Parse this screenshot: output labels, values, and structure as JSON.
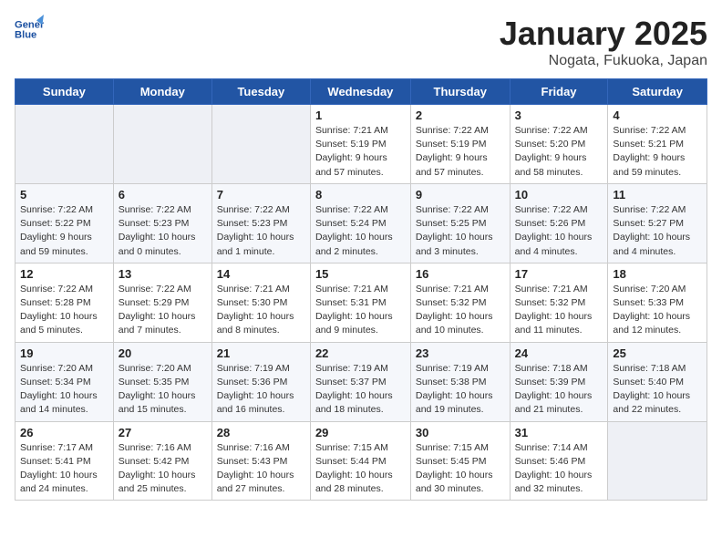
{
  "header": {
    "logo_line1": "General",
    "logo_line2": "Blue",
    "month": "January 2025",
    "location": "Nogata, Fukuoka, Japan"
  },
  "weekdays": [
    "Sunday",
    "Monday",
    "Tuesday",
    "Wednesday",
    "Thursday",
    "Friday",
    "Saturday"
  ],
  "weeks": [
    [
      {
        "day": "",
        "empty": true
      },
      {
        "day": "",
        "empty": true
      },
      {
        "day": "",
        "empty": true
      },
      {
        "day": "1",
        "sunrise": "Sunrise: 7:21 AM",
        "sunset": "Sunset: 5:19 PM",
        "daylight": "Daylight: 9 hours and 57 minutes."
      },
      {
        "day": "2",
        "sunrise": "Sunrise: 7:22 AM",
        "sunset": "Sunset: 5:19 PM",
        "daylight": "Daylight: 9 hours and 57 minutes."
      },
      {
        "day": "3",
        "sunrise": "Sunrise: 7:22 AM",
        "sunset": "Sunset: 5:20 PM",
        "daylight": "Daylight: 9 hours and 58 minutes."
      },
      {
        "day": "4",
        "sunrise": "Sunrise: 7:22 AM",
        "sunset": "Sunset: 5:21 PM",
        "daylight": "Daylight: 9 hours and 59 minutes."
      }
    ],
    [
      {
        "day": "5",
        "sunrise": "Sunrise: 7:22 AM",
        "sunset": "Sunset: 5:22 PM",
        "daylight": "Daylight: 9 hours and 59 minutes."
      },
      {
        "day": "6",
        "sunrise": "Sunrise: 7:22 AM",
        "sunset": "Sunset: 5:23 PM",
        "daylight": "Daylight: 10 hours and 0 minutes."
      },
      {
        "day": "7",
        "sunrise": "Sunrise: 7:22 AM",
        "sunset": "Sunset: 5:23 PM",
        "daylight": "Daylight: 10 hours and 1 minute."
      },
      {
        "day": "8",
        "sunrise": "Sunrise: 7:22 AM",
        "sunset": "Sunset: 5:24 PM",
        "daylight": "Daylight: 10 hours and 2 minutes."
      },
      {
        "day": "9",
        "sunrise": "Sunrise: 7:22 AM",
        "sunset": "Sunset: 5:25 PM",
        "daylight": "Daylight: 10 hours and 3 minutes."
      },
      {
        "day": "10",
        "sunrise": "Sunrise: 7:22 AM",
        "sunset": "Sunset: 5:26 PM",
        "daylight": "Daylight: 10 hours and 4 minutes."
      },
      {
        "day": "11",
        "sunrise": "Sunrise: 7:22 AM",
        "sunset": "Sunset: 5:27 PM",
        "daylight": "Daylight: 10 hours and 4 minutes."
      }
    ],
    [
      {
        "day": "12",
        "sunrise": "Sunrise: 7:22 AM",
        "sunset": "Sunset: 5:28 PM",
        "daylight": "Daylight: 10 hours and 5 minutes."
      },
      {
        "day": "13",
        "sunrise": "Sunrise: 7:22 AM",
        "sunset": "Sunset: 5:29 PM",
        "daylight": "Daylight: 10 hours and 7 minutes."
      },
      {
        "day": "14",
        "sunrise": "Sunrise: 7:21 AM",
        "sunset": "Sunset: 5:30 PM",
        "daylight": "Daylight: 10 hours and 8 minutes."
      },
      {
        "day": "15",
        "sunrise": "Sunrise: 7:21 AM",
        "sunset": "Sunset: 5:31 PM",
        "daylight": "Daylight: 10 hours and 9 minutes."
      },
      {
        "day": "16",
        "sunrise": "Sunrise: 7:21 AM",
        "sunset": "Sunset: 5:32 PM",
        "daylight": "Daylight: 10 hours and 10 minutes."
      },
      {
        "day": "17",
        "sunrise": "Sunrise: 7:21 AM",
        "sunset": "Sunset: 5:32 PM",
        "daylight": "Daylight: 10 hours and 11 minutes."
      },
      {
        "day": "18",
        "sunrise": "Sunrise: 7:20 AM",
        "sunset": "Sunset: 5:33 PM",
        "daylight": "Daylight: 10 hours and 12 minutes."
      }
    ],
    [
      {
        "day": "19",
        "sunrise": "Sunrise: 7:20 AM",
        "sunset": "Sunset: 5:34 PM",
        "daylight": "Daylight: 10 hours and 14 minutes."
      },
      {
        "day": "20",
        "sunrise": "Sunrise: 7:20 AM",
        "sunset": "Sunset: 5:35 PM",
        "daylight": "Daylight: 10 hours and 15 minutes."
      },
      {
        "day": "21",
        "sunrise": "Sunrise: 7:19 AM",
        "sunset": "Sunset: 5:36 PM",
        "daylight": "Daylight: 10 hours and 16 minutes."
      },
      {
        "day": "22",
        "sunrise": "Sunrise: 7:19 AM",
        "sunset": "Sunset: 5:37 PM",
        "daylight": "Daylight: 10 hours and 18 minutes."
      },
      {
        "day": "23",
        "sunrise": "Sunrise: 7:19 AM",
        "sunset": "Sunset: 5:38 PM",
        "daylight": "Daylight: 10 hours and 19 minutes."
      },
      {
        "day": "24",
        "sunrise": "Sunrise: 7:18 AM",
        "sunset": "Sunset: 5:39 PM",
        "daylight": "Daylight: 10 hours and 21 minutes."
      },
      {
        "day": "25",
        "sunrise": "Sunrise: 7:18 AM",
        "sunset": "Sunset: 5:40 PM",
        "daylight": "Daylight: 10 hours and 22 minutes."
      }
    ],
    [
      {
        "day": "26",
        "sunrise": "Sunrise: 7:17 AM",
        "sunset": "Sunset: 5:41 PM",
        "daylight": "Daylight: 10 hours and 24 minutes."
      },
      {
        "day": "27",
        "sunrise": "Sunrise: 7:16 AM",
        "sunset": "Sunset: 5:42 PM",
        "daylight": "Daylight: 10 hours and 25 minutes."
      },
      {
        "day": "28",
        "sunrise": "Sunrise: 7:16 AM",
        "sunset": "Sunset: 5:43 PM",
        "daylight": "Daylight: 10 hours and 27 minutes."
      },
      {
        "day": "29",
        "sunrise": "Sunrise: 7:15 AM",
        "sunset": "Sunset: 5:44 PM",
        "daylight": "Daylight: 10 hours and 28 minutes."
      },
      {
        "day": "30",
        "sunrise": "Sunrise: 7:15 AM",
        "sunset": "Sunset: 5:45 PM",
        "daylight": "Daylight: 10 hours and 30 minutes."
      },
      {
        "day": "31",
        "sunrise": "Sunrise: 7:14 AM",
        "sunset": "Sunset: 5:46 PM",
        "daylight": "Daylight: 10 hours and 32 minutes."
      },
      {
        "day": "",
        "empty": true
      }
    ]
  ]
}
